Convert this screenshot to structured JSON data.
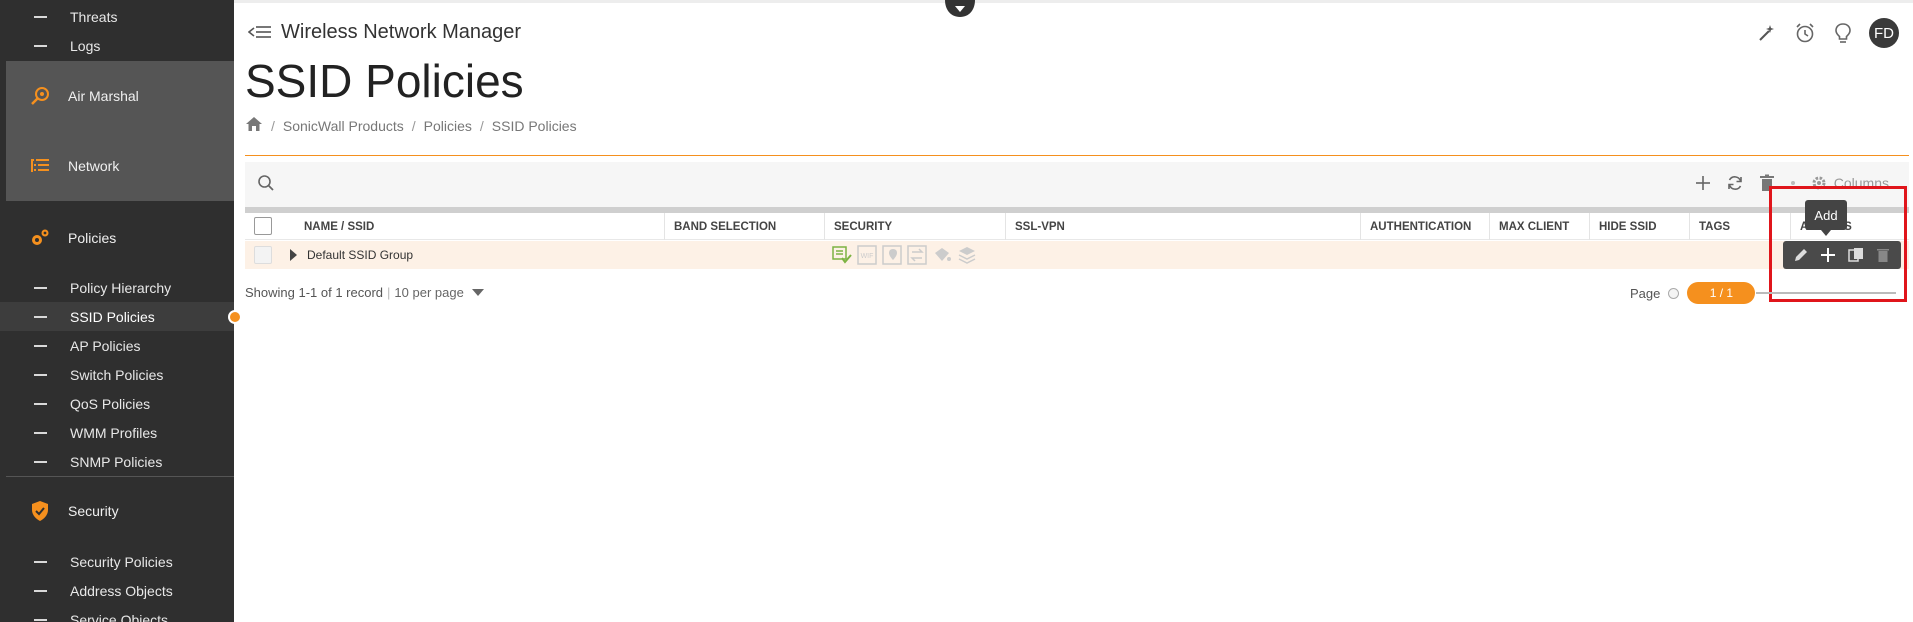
{
  "sidebar": {
    "items_top": [
      {
        "label": "Threats"
      },
      {
        "label": "Logs"
      }
    ],
    "groups": [
      {
        "label": "Air Marshal",
        "icon": "air-marshal-icon"
      },
      {
        "label": "Network",
        "icon": "network-list-icon"
      }
    ],
    "policies": {
      "label": "Policies",
      "icon": "policies-gear-icon",
      "items": [
        {
          "label": "Policy Hierarchy"
        },
        {
          "label": "SSID Policies"
        },
        {
          "label": "AP Policies"
        },
        {
          "label": "Switch Policies"
        },
        {
          "label": "QoS Policies"
        },
        {
          "label": "WMM Profiles"
        },
        {
          "label": "SNMP Policies"
        }
      ]
    },
    "security": {
      "label": "Security",
      "icon": "shield-icon",
      "items": [
        {
          "label": "Security Policies"
        },
        {
          "label": "Address Objects"
        },
        {
          "label": "Service Objects"
        }
      ]
    }
  },
  "header": {
    "app_title": "Wireless Network Manager",
    "avatar_initials": "FD",
    "icons": [
      "magic-wand-icon",
      "alarm-clock-icon",
      "lightbulb-icon"
    ]
  },
  "page": {
    "title": "SSID Policies",
    "breadcrumb": [
      "SonicWall Products",
      "Policies",
      "SSID Policies"
    ]
  },
  "toolbar": {
    "columns_label": "Columns"
  },
  "table": {
    "columns": [
      "NAME / SSID",
      "BAND SELECTION",
      "SECURITY",
      "SSL-VPN",
      "AUTHENTICATION",
      "MAX CLIENT",
      "HIDE SSID",
      "TAGS",
      "ACTIONS"
    ],
    "rows": [
      {
        "name": "Default SSID Group"
      }
    ]
  },
  "tooltip": {
    "label": "Add"
  },
  "footer": {
    "showing": "Showing 1-1 of 1 record",
    "per_page": "10 per page",
    "page_label": "Page",
    "page_value": "1 / 1"
  },
  "colors": {
    "accent": "#f5901e",
    "sidebar_bg": "#2f2f2f",
    "highlight": "#e0151b",
    "security_icon_green": "#7cb342"
  }
}
